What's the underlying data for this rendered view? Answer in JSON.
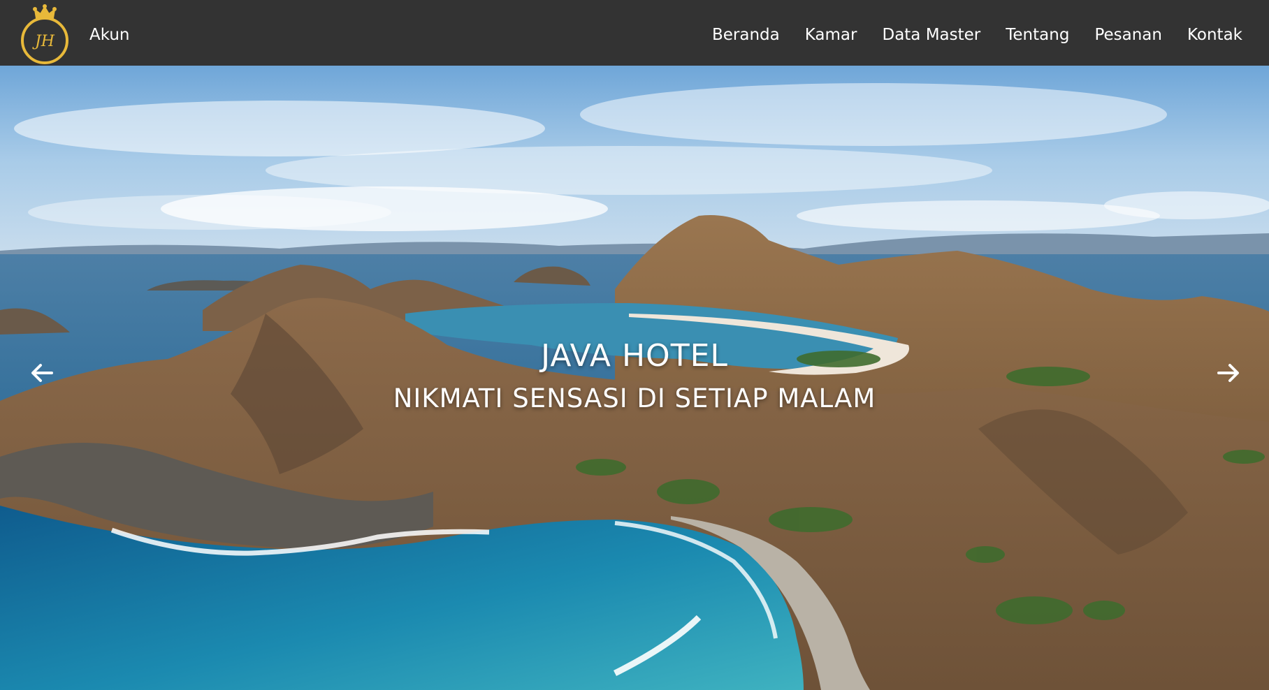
{
  "navbar": {
    "logo_text": "JH",
    "account_label": "Akun",
    "links": [
      "Beranda",
      "Kamar",
      "Data Master",
      "Tentang",
      "Pesanan",
      "Kontak"
    ]
  },
  "hero": {
    "title": "JAVA HOTEL",
    "subtitle": "NIKMATI SENSASI DI SETIAP MALAM",
    "prev_icon": "arrow-left-icon",
    "next_icon": "arrow-right-icon"
  },
  "colors": {
    "navbar_bg": "#333333",
    "logo_gold": "#e8b93a",
    "text": "#ffffff"
  }
}
